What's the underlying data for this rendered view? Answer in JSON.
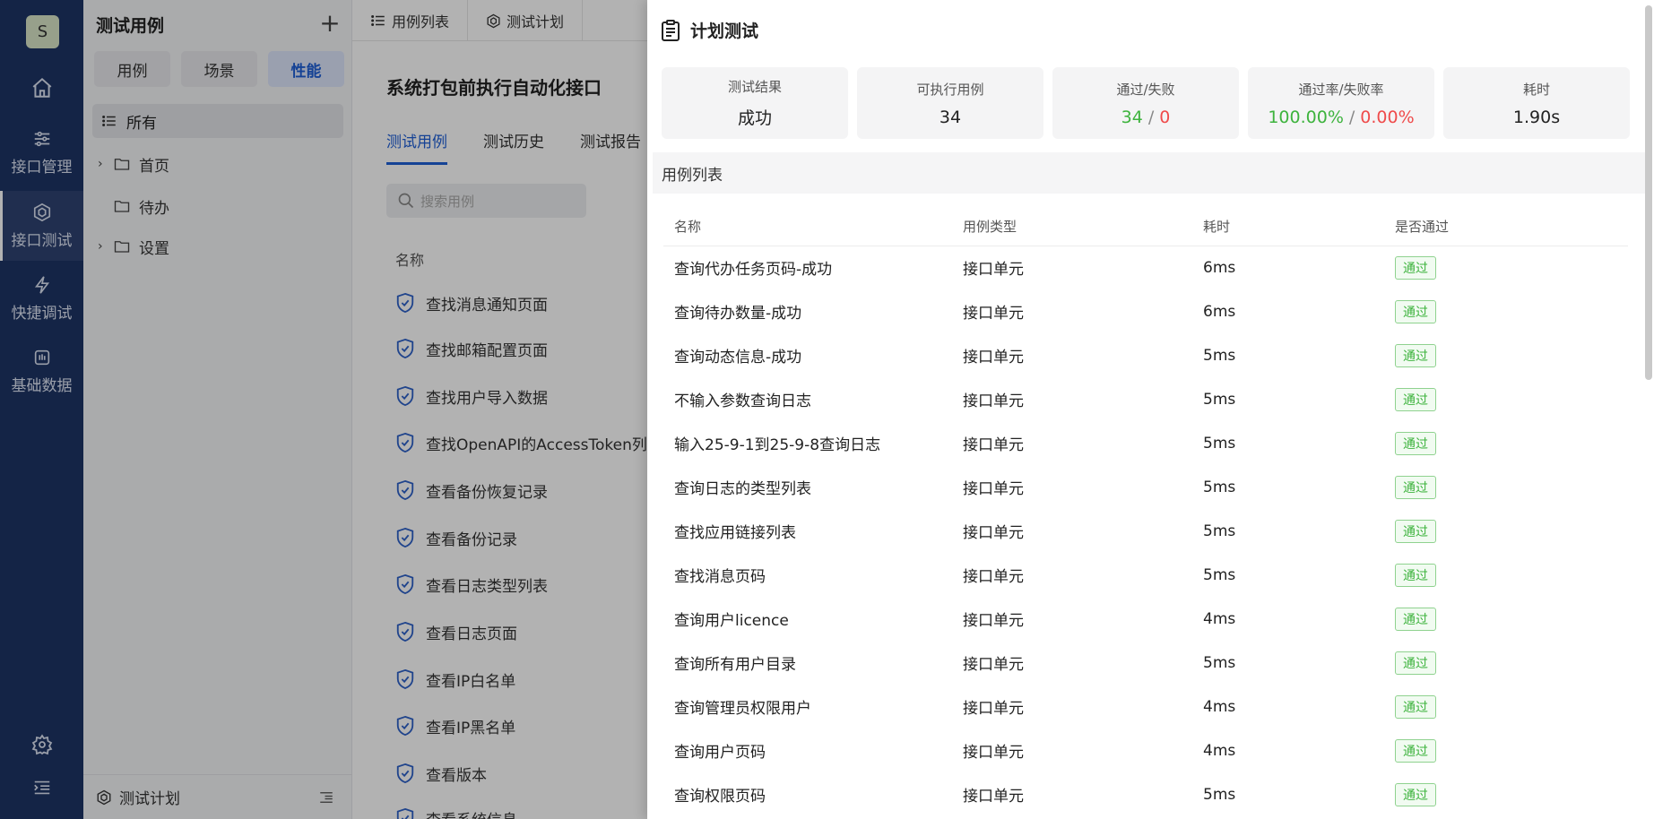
{
  "rail": {
    "avatar_letter": "S",
    "nav": [
      {
        "label": "接口管理",
        "icon": "sliders-icon"
      },
      {
        "label": "接口测试",
        "icon": "cube-icon",
        "active": true
      },
      {
        "label": "快捷调试",
        "icon": "lightning-icon"
      },
      {
        "label": "基础数据",
        "icon": "database-icon"
      }
    ]
  },
  "tree": {
    "title": "测试用例",
    "type_tabs": [
      "用例",
      "场景",
      "性能"
    ],
    "active_type": "性能",
    "all_label": "所有",
    "nodes": [
      {
        "label": "首页",
        "expandable": true
      },
      {
        "label": "待办",
        "expandable": false
      },
      {
        "label": "设置",
        "expandable": true
      }
    ],
    "footer_label": "测试计划"
  },
  "main": {
    "top_tabs": [
      "用例列表",
      "测试计划"
    ],
    "suite_title": "系统打包前执行自动化接口",
    "subtabs": [
      "测试用例",
      "测试历史",
      "测试报告"
    ],
    "active_subtab": "测试用例",
    "search_placeholder": "搜索用例",
    "col_name": "名称",
    "cases": [
      "查找消息通知页面",
      "查找邮箱配置页面",
      "查找用户导入数据",
      "查找OpenAPI的AccessToken列表",
      "查看备份恢复记录",
      "查看备份记录",
      "查看日志类型列表",
      "查看日志页面",
      "查看IP白名单",
      "查看IP黑名单",
      "查看版本",
      "查看系统信息"
    ]
  },
  "drawer": {
    "title": "计划测试",
    "stats": {
      "result_label": "测试结果",
      "result_value": "成功",
      "exec_label": "可执行用例",
      "exec_value": "34",
      "pf_label": "通过/失败",
      "pass_count": "34",
      "fail_count": "0",
      "rate_label": "通过率/失败率",
      "pass_rate": "100.00%",
      "fail_rate": "0.00%",
      "time_label": "耗时",
      "time_value": "1.90s"
    },
    "section_label": "用例列表",
    "table": {
      "headers": [
        "名称",
        "用例类型",
        "耗时",
        "是否通过"
      ],
      "rows": [
        [
          "查询代办任务页码-成功",
          "接口单元",
          "6ms",
          "通过"
        ],
        [
          "查询待办数量-成功",
          "接口单元",
          "6ms",
          "通过"
        ],
        [
          "查询动态信息-成功",
          "接口单元",
          "5ms",
          "通过"
        ],
        [
          "不输入参数查询日志",
          "接口单元",
          "5ms",
          "通过"
        ],
        [
          "输入25-9-1到25-9-8查询日志",
          "接口单元",
          "5ms",
          "通过"
        ],
        [
          "查询日志的类型列表",
          "接口单元",
          "5ms",
          "通过"
        ],
        [
          "查找应用链接列表",
          "接口单元",
          "5ms",
          "通过"
        ],
        [
          "查找消息页码",
          "接口单元",
          "5ms",
          "通过"
        ],
        [
          "查询用户licence",
          "接口单元",
          "4ms",
          "通过"
        ],
        [
          "查询所有用户目录",
          "接口单元",
          "5ms",
          "通过"
        ],
        [
          "查询管理员权限用户",
          "接口单元",
          "4ms",
          "通过"
        ],
        [
          "查询用户页码",
          "接口单元",
          "4ms",
          "通过"
        ],
        [
          "查询权限页码",
          "接口单元",
          "5ms",
          "通过"
        ]
      ]
    },
    "colors": {
      "pass": "#3db33d",
      "fail": "#ef4b4b",
      "accent": "#1f5fd6",
      "rail": "#1e3465"
    }
  }
}
